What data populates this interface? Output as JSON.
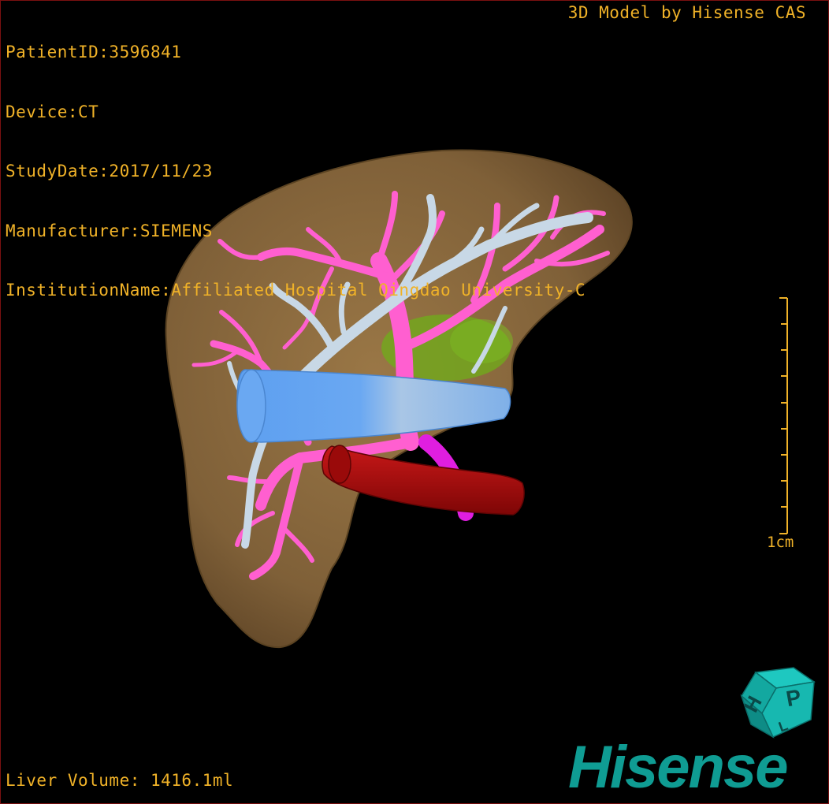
{
  "dicom": {
    "patient_id": "PatientID:3596841",
    "device": "Device:CT",
    "study_date": "StudyDate:2017/11/23",
    "manufacturer": "Manufacturer:SIEMENS",
    "institution": "InstitutionName:Affiliated Hospital Qingdao University-C"
  },
  "header": {
    "credit": "3D Model by Hisense CAS"
  },
  "footer": {
    "liver_volume": "Liver Volume: 1416.1ml"
  },
  "scale_bar": {
    "label": "1cm"
  },
  "logo": {
    "wordmark": "Hisense",
    "cube_letters": [
      "H",
      "P",
      "L"
    ]
  },
  "colors": {
    "overlay_text": "#f0b228",
    "liver": "#8a6a3e",
    "portal_vein": "#ff5fd0",
    "hepatic_vein": "#c8d8e6",
    "ivc": "#5a9cec",
    "aorta": "#b00c0c",
    "gallbladder": "#6fae1a",
    "brand": "#0f9c93"
  }
}
